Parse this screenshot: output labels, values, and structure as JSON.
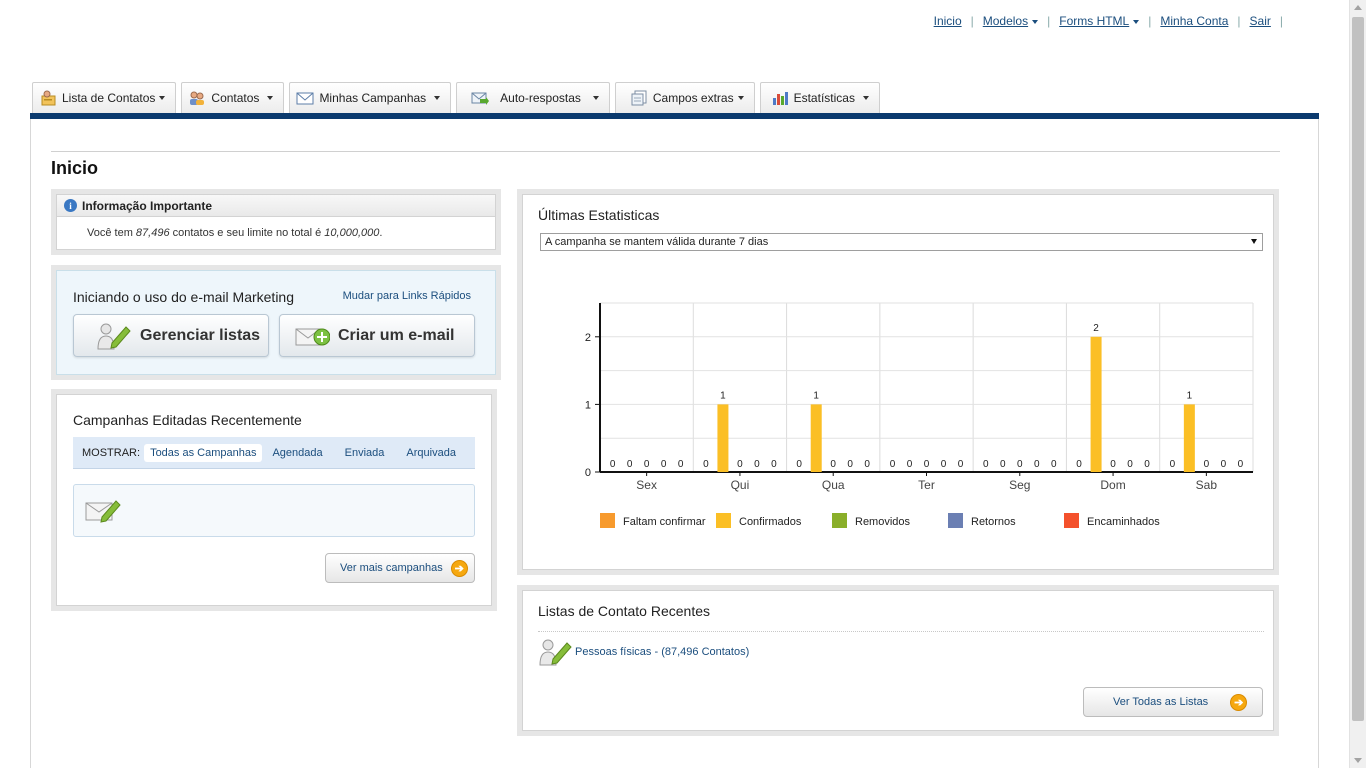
{
  "top_links": {
    "inicio": "Inicio",
    "modelos": "Modelos",
    "forms_html": "Forms HTML",
    "minha_conta": "Minha Conta",
    "sair": "Sair"
  },
  "nav_tabs": [
    {
      "label": "Lista de Contatos",
      "icon": "contact-list-icon"
    },
    {
      "label": "Contatos",
      "icon": "contacts-icon"
    },
    {
      "label": "Minhas Campanhas",
      "icon": "envelope-icon"
    },
    {
      "label": "Auto-respostas",
      "icon": "auto-reply-icon"
    },
    {
      "label": "Campos extras",
      "icon": "extra-fields-icon"
    },
    {
      "label": "Estatísticas",
      "icon": "statistics-icon"
    }
  ],
  "page_title": "Inicio",
  "info": {
    "title": "Informação Importante",
    "text_prefix": "Você tem",
    "contacts": "87,496",
    "text_middle": "contatos e seu limite no total é",
    "limit": "10,000,000",
    "text_suffix": "."
  },
  "quick_start": {
    "title": "Iniciando o uso do e-mail Marketing",
    "switch_link": "Mudar para Links Rápidos",
    "manage_lists": "Gerenciar listas",
    "create_email": "Criar um e-mail"
  },
  "campaigns": {
    "title": "Campanhas Editadas Recentemente",
    "filter_label": "MOSTRAR:",
    "filters": [
      "Todas as Campanhas",
      "Agendada",
      "Enviada",
      "Arquivada"
    ],
    "more_button": "Ver mais campanhas"
  },
  "stats": {
    "title": "Últimas Estatisticas",
    "period_select": "A campanha se mantem válida durante 7 dias"
  },
  "chart_data": {
    "type": "bar",
    "categories": [
      "Sex",
      "Qui",
      "Qua",
      "Ter",
      "Seg",
      "Dom",
      "Sab"
    ],
    "series": [
      {
        "name": "Faltam confirmar",
        "color": "#f79a2d",
        "values": [
          0,
          0,
          0,
          0,
          0,
          0,
          0
        ]
      },
      {
        "name": "Confirmados",
        "color": "#fbbf25",
        "values": [
          0,
          1,
          1,
          0,
          0,
          2,
          1
        ]
      },
      {
        "name": "Removidos",
        "color": "#8aaf2a",
        "values": [
          0,
          0,
          0,
          0,
          0,
          0,
          0
        ]
      },
      {
        "name": "Retornos",
        "color": "#6b7fb3",
        "values": [
          0,
          0,
          0,
          0,
          0,
          0,
          0
        ]
      },
      {
        "name": "Encaminhados",
        "color": "#f4512c",
        "values": [
          0,
          0,
          0,
          0,
          0,
          0,
          0
        ]
      }
    ],
    "yticks": [
      0,
      1,
      2
    ],
    "ylim": [
      0,
      2.5
    ],
    "grid": true,
    "legend": "bottom",
    "data_labels": true
  },
  "recent_lists": {
    "title": "Listas de Contato Recentes",
    "items": [
      {
        "name": "Pessoas físicas",
        "count_text": "(87,496 Contatos)"
      }
    ],
    "all_button": "Ver Todas as Listas"
  }
}
